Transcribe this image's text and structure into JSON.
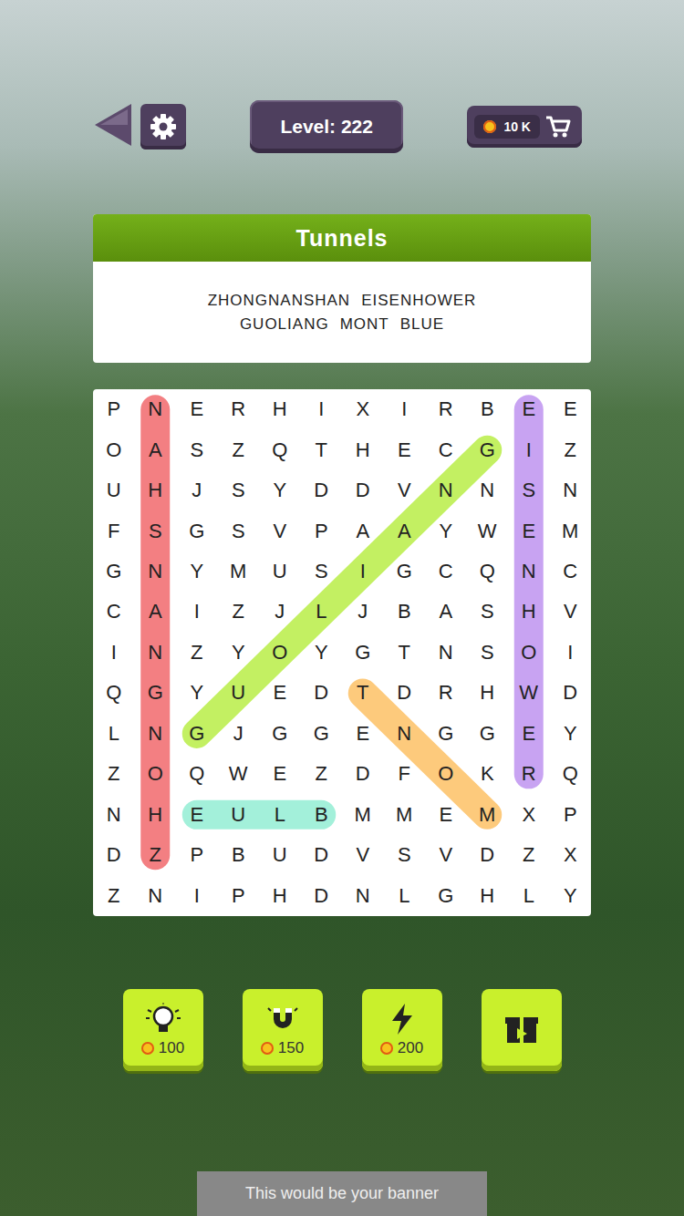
{
  "header": {
    "level": "Level: 222",
    "coins": "10 K"
  },
  "category": {
    "title": "Tunnels",
    "word_lines": [
      [
        "ZHONGNANSHAN",
        "EISENHOWER"
      ],
      [
        "GUOLIANG",
        "MONT",
        "BLUE"
      ]
    ]
  },
  "grid": [
    [
      "P",
      "N",
      "E",
      "R",
      "H",
      "I",
      "X",
      "I",
      "R",
      "B",
      "E",
      "E"
    ],
    [
      "O",
      "A",
      "S",
      "Z",
      "Q",
      "T",
      "H",
      "E",
      "C",
      "G",
      "I",
      "Z"
    ],
    [
      "U",
      "H",
      "J",
      "S",
      "Y",
      "D",
      "D",
      "V",
      "N",
      "N",
      "S",
      "N"
    ],
    [
      "F",
      "S",
      "G",
      "S",
      "V",
      "P",
      "A",
      "A",
      "Y",
      "W",
      "E",
      "M"
    ],
    [
      "G",
      "N",
      "Y",
      "M",
      "U",
      "S",
      "I",
      "G",
      "C",
      "Q",
      "N",
      "C"
    ],
    [
      "C",
      "A",
      "I",
      "Z",
      "J",
      "L",
      "J",
      "B",
      "A",
      "S",
      "H",
      "V"
    ],
    [
      "I",
      "N",
      "Z",
      "Y",
      "O",
      "Y",
      "G",
      "T",
      "N",
      "S",
      "O",
      "I"
    ],
    [
      "Q",
      "G",
      "Y",
      "U",
      "E",
      "D",
      "T",
      "D",
      "R",
      "H",
      "W",
      "D"
    ],
    [
      "L",
      "N",
      "G",
      "J",
      "G",
      "G",
      "E",
      "N",
      "G",
      "G",
      "E",
      "Y"
    ],
    [
      "Z",
      "O",
      "Q",
      "W",
      "E",
      "Z",
      "D",
      "F",
      "O",
      "K",
      "R",
      "Q"
    ],
    [
      "N",
      "H",
      "E",
      "U",
      "L",
      "B",
      "M",
      "M",
      "E",
      "M",
      "X",
      "P"
    ],
    [
      "D",
      "Z",
      "P",
      "B",
      "U",
      "D",
      "V",
      "S",
      "V",
      "D",
      "Z",
      "X"
    ],
    [
      "Z",
      "N",
      "I",
      "P",
      "H",
      "D",
      "N",
      "L",
      "G",
      "H",
      "L",
      "Y"
    ]
  ],
  "found": [
    {
      "word": "ZHONGNANSHAN",
      "from": [
        11,
        1
      ],
      "to": [
        0,
        1
      ],
      "color": "#f37f82"
    },
    {
      "word": "EISENHOWER",
      "from": [
        0,
        10
      ],
      "to": [
        9,
        10
      ],
      "color": "#c8a3f2"
    },
    {
      "word": "GUOLIANG",
      "from": [
        8,
        2
      ],
      "to": [
        1,
        9
      ],
      "color": "#c3f062"
    },
    {
      "word": "MONT",
      "from": [
        10,
        9
      ],
      "to": [
        7,
        6
      ],
      "color": "#fdca7c"
    },
    {
      "word": "BLUE",
      "from": [
        10,
        5
      ],
      "to": [
        10,
        2
      ],
      "color": "#a3f0da"
    }
  ],
  "powerups": [
    {
      "kind": "hint",
      "cost": "100"
    },
    {
      "kind": "magnet",
      "cost": "150"
    },
    {
      "kind": "bolt",
      "cost": "200"
    },
    {
      "kind": "video"
    }
  ],
  "banner": "This would be your banner"
}
